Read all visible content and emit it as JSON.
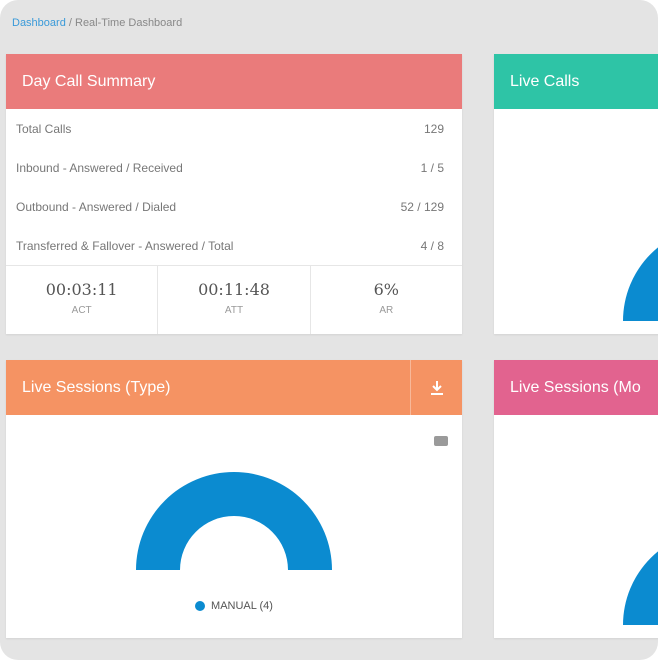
{
  "breadcrumb": {
    "root": "Dashboard",
    "separator": " / ",
    "current": "Real-Time Dashboard"
  },
  "day_call_summary": {
    "title": "Day Call Summary",
    "color": "#ea7b7b",
    "rows": [
      {
        "label": "Total Calls",
        "value": "129"
      },
      {
        "label": "Inbound - Answered / Received",
        "value": "1 / 5"
      },
      {
        "label": "Outbound - Answered / Dialed",
        "value": "52 / 129"
      },
      {
        "label": "Transferred & Fallover - Answered / Total",
        "value": "4 / 8"
      }
    ],
    "metrics": [
      {
        "value": "00:03:11",
        "label": "ACT"
      },
      {
        "value": "00:11:48",
        "label": "ATT"
      },
      {
        "value": "6%",
        "label": "AR"
      }
    ]
  },
  "live_calls": {
    "title": "Live Calls",
    "color": "#2ec4a6",
    "gauge_color": "#0b8bd0"
  },
  "live_sessions_type": {
    "title": "Live Sessions (Type)",
    "color": "#f59363",
    "download_icon": "download-icon",
    "menu_icon": "chart-menu-icon",
    "gauge_color": "#0b8bd0",
    "legend": [
      {
        "label": "MANUAL (4)",
        "color": "#0b8bd0"
      }
    ]
  },
  "live_sessions_mode": {
    "title": "Live Sessions (Mo",
    "color": "#e2638f",
    "gauge_color": "#0b8bd0"
  }
}
